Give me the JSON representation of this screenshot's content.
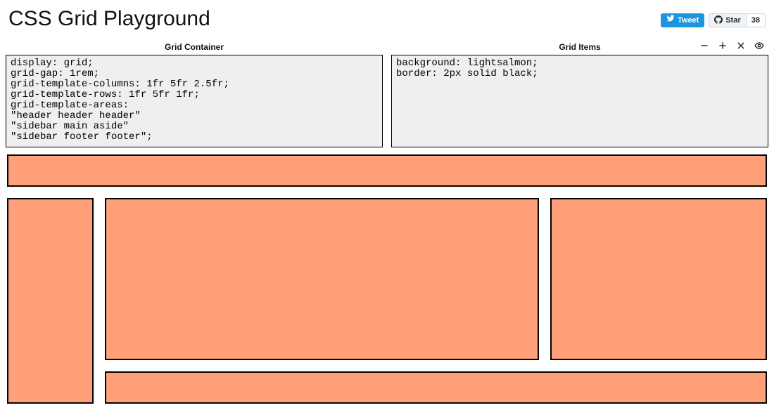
{
  "page_title": "CSS Grid Playground",
  "social": {
    "tweet_label": "Tweet",
    "star_label": "Star",
    "star_count": "38"
  },
  "editors": {
    "container_label": "Grid Container",
    "items_label": "Grid Items",
    "container_code": "display: grid;\ngrid-gap: 1rem;\ngrid-template-columns: 1fr 5fr 2.5fr;\ngrid-template-rows: 1fr 5fr 1fr;\ngrid-template-areas:\n\"header header header\"\n\"sidebar main aside\"\n\"sidebar footer footer\";",
    "items_code": "background: lightsalmon;\nborder: 2px solid black;"
  },
  "preview": {
    "item_background": "lightsalmon",
    "item_border": "2px solid black",
    "grid_gap": "1rem",
    "columns": "1fr 5fr 2.5fr",
    "rows": "1fr 5fr 1fr",
    "areas": [
      "header header header",
      "sidebar main aside",
      "sidebar footer footer"
    ],
    "cells": [
      "header",
      "sidebar",
      "main",
      "aside",
      "footer"
    ]
  }
}
